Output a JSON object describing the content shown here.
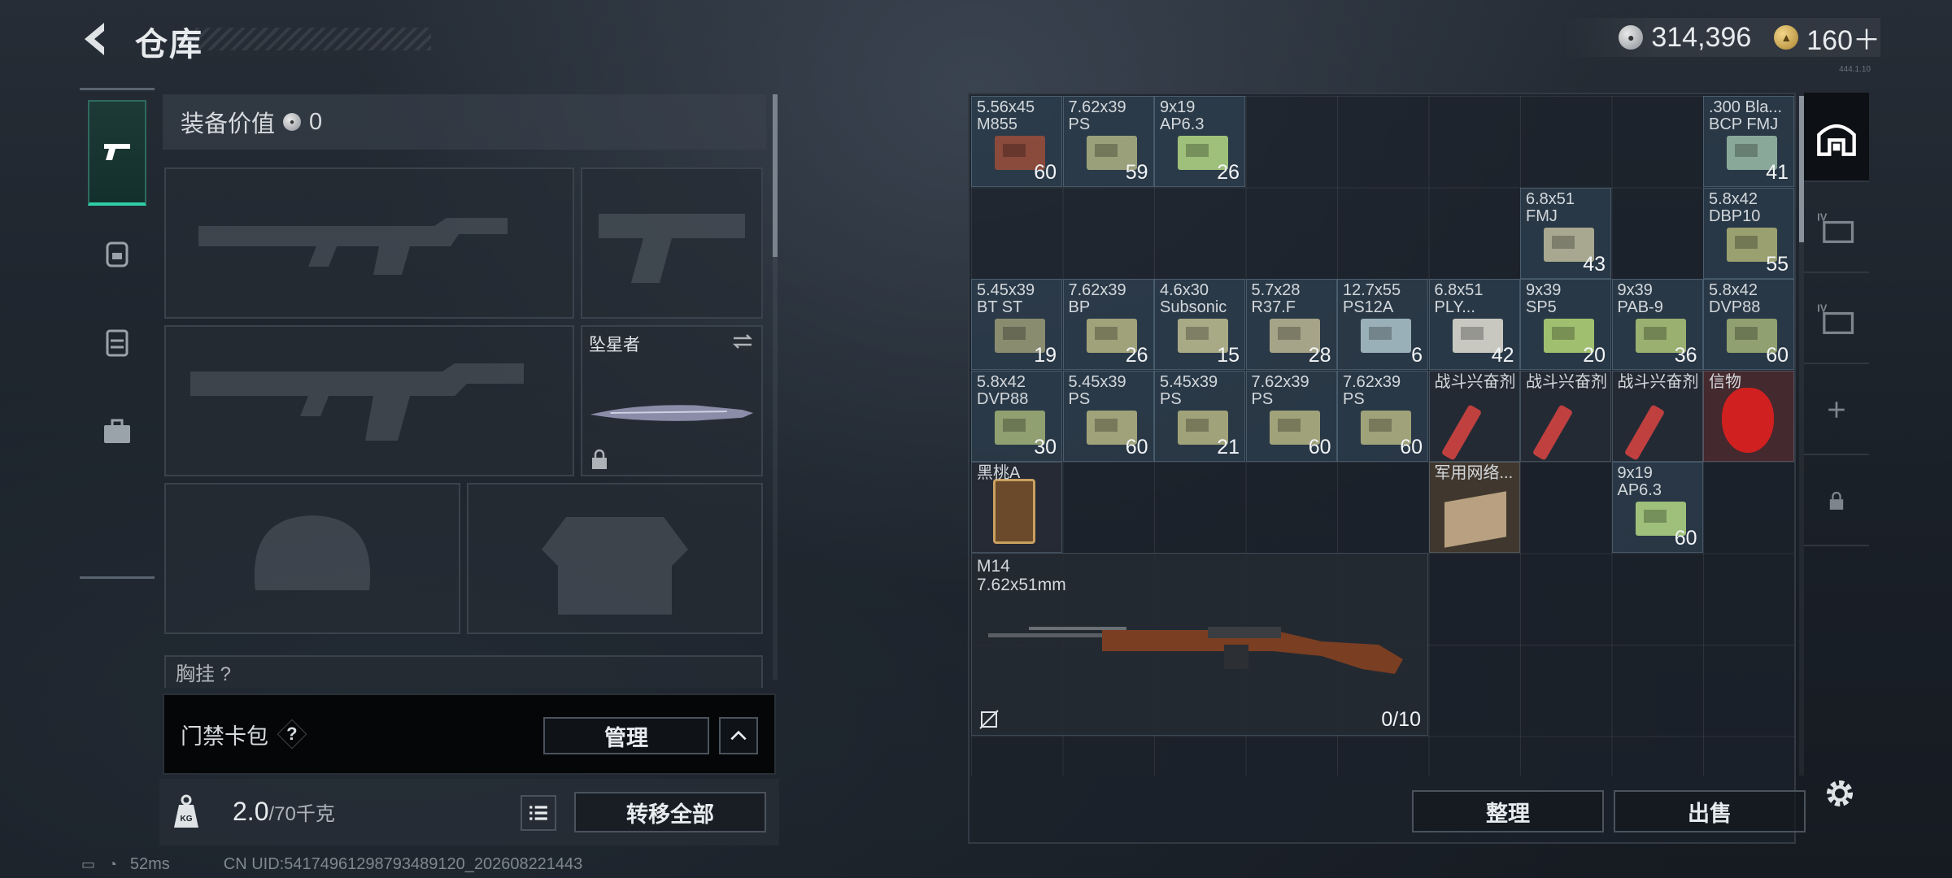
{
  "header": {
    "title": "仓库",
    "silver_amount": "314,396",
    "gold_amount": "160＋",
    "version": "444.1.10"
  },
  "loadout": {
    "value_label": "装备价值",
    "value_amount": "0",
    "melee_label": "坠星者",
    "chest_label": "胸挂 ?"
  },
  "keycard": {
    "label": "门禁卡包",
    "help": "?",
    "manage_label": "管理"
  },
  "weight": {
    "current": "2.0",
    "max": "/70千克",
    "transfer_all": "转移全部"
  },
  "status": {
    "ping": "52ms",
    "uid": "CN UID:5417496129879348912​0_202608221443"
  },
  "stash_items": [
    {
      "name": "5.56x45\nM855",
      "qty": "60",
      "color": "#8a4a3c",
      "style": ""
    },
    {
      "name": "7.62x39\nPS",
      "qty": "59",
      "color": "#9aa07a",
      "style": ""
    },
    {
      "name": "9x19\nAP6.3",
      "qty": "26",
      "color": "#9ec07a",
      "style": ""
    },
    {
      "name": ".300 Bla...\nBCP FMJ",
      "qty": "41",
      "color": "#8aa89a",
      "style": ""
    },
    {
      "name": "6.8x51\nFMJ",
      "qty": "43",
      "color": "#a8a890",
      "style": ""
    },
    {
      "name": "5.8x42\nDBP10",
      "qty": "55",
      "color": "#9aa070",
      "style": ""
    },
    {
      "name": "5.45x39\nBT ST",
      "qty": "19",
      "color": "#8a8c70",
      "style": ""
    },
    {
      "name": "7.62x39\nBP",
      "qty": "26",
      "color": "#a0a27a",
      "style": ""
    },
    {
      "name": "4.6x30\nSubsonic",
      "qty": "15",
      "color": "#a8aa86",
      "style": ""
    },
    {
      "name": "5.7x28\nR37.F",
      "qty": "28",
      "color": "#a6a488",
      "style": ""
    },
    {
      "name": "12.7x55\nPS12A",
      "qty": "6",
      "color": "#9ab0b8",
      "style": ""
    },
    {
      "name": "6.8x51\nPLY...",
      "qty": "42",
      "color": "#c8c8c0",
      "style": ""
    },
    {
      "name": "9x39\nSP5",
      "qty": "20",
      "color": "#a0c070",
      "style": ""
    },
    {
      "name": "9x39\nPAB-9",
      "qty": "36",
      "color": "#9ab070",
      "style": ""
    },
    {
      "name": "5.8x42\nDVP88",
      "qty": "60",
      "color": "#90a070",
      "style": ""
    },
    {
      "name": "5.8x42\nDVP88",
      "qty": "30",
      "color": "#90a070",
      "style": ""
    },
    {
      "name": "5.45x39\nPS",
      "qty": "60",
      "color": "#a0a27a",
      "style": ""
    },
    {
      "name": "5.45x39\nPS",
      "qty": "21",
      "color": "#a0a27a",
      "style": ""
    },
    {
      "name": "7.62x39\nPS",
      "qty": "60",
      "color": "#a0a27a",
      "style": ""
    },
    {
      "name": "7.62x39\nPS",
      "qty": "60",
      "color": "#a0a27a",
      "style": ""
    },
    {
      "name": "战斗兴奋剂",
      "qty": "",
      "color": "#c04040",
      "style": "dark"
    },
    {
      "name": "战斗兴奋剂",
      "qty": "",
      "color": "#c04040",
      "style": "dark"
    },
    {
      "name": "战斗兴奋剂",
      "qty": "",
      "color": "#c04040",
      "style": "dark"
    },
    {
      "name": "信物",
      "qty": "",
      "color": "#d02020",
      "style": "red"
    },
    {
      "name": "黑桃A",
      "qty": "",
      "color": "#c9a060",
      "style": "dark"
    },
    {
      "name": "军用网络...",
      "qty": "",
      "color": "#b8a080",
      "style": "tan"
    },
    {
      "name": "9x19\nAP6.3",
      "qty": "60",
      "color": "#9ec07a",
      "style": ""
    }
  ],
  "m14": {
    "name": "M14\n7.62x51mm",
    "qty": "0/10"
  },
  "stash_buttons": {
    "sort": "整理",
    "sell": "出售"
  },
  "colors": {
    "accent": "#2fd0a6",
    "panel": "#1c222a"
  }
}
